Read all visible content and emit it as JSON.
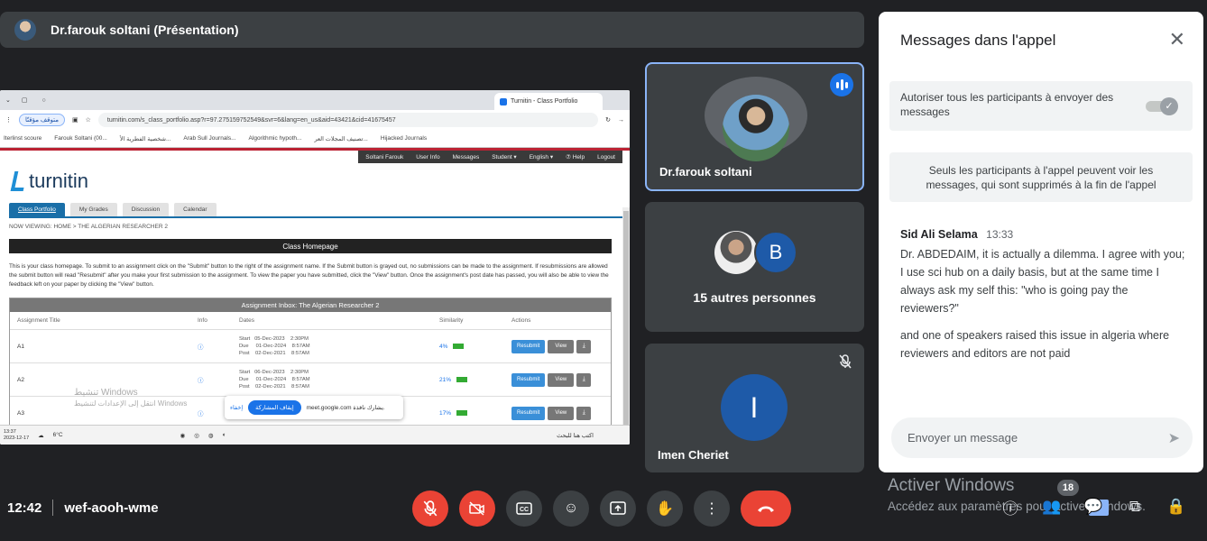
{
  "presenter": {
    "label": "Dr.farouk soltani (Présentation)"
  },
  "shared_screen": {
    "tab_title": "Turnitin - Class Portfolio",
    "pill_label": "متوقف مؤقتًا",
    "url": "turnitin.com/s_class_portfolio.asp?r=97.275159752549&svr=6&lang=en_us&aid=43421&cid=41675457",
    "bookmarks": [
      "Iterlinst scoure",
      "Farouk Soltani (00...",
      "شخصية الفطرية الأ...",
      "Arab Sull Journals...",
      "Algorithmic hypoth...",
      "تصنيف المجلات العر...",
      "Hijacked Journals"
    ],
    "topnav": [
      "Soltani Farouk",
      "User Info",
      "Messages",
      "Student ▾",
      "English ▾",
      "⑦ Help",
      "Logout"
    ],
    "logo": "turnitin",
    "tabs": [
      "Class Portfolio",
      "My Grades",
      "Discussion",
      "Calendar"
    ],
    "now_viewing": "NOW VIEWING: HOME > THE ALGERIAN RESEARCHER 2",
    "class_homepage": "Class Homepage",
    "intro": "This is your class homepage. To submit to an assignment click on the \"Submit\" button to the right of the assignment name. If the Submit button is grayed out, no submissions can be made to the assignment. If resubmissions are allowed the submit button will read \"Resubmit\" after you make your first submission to the assignment. To view the paper you have submitted, click the \"View\" button. Once the assignment's post date has passed, you will also be able to view the feedback left on your paper by clicking the \"View\" button.",
    "inbox_title": "Assignment Inbox: The Algerian Researcher 2",
    "columns": [
      "Assignment Title",
      "Info",
      "Dates",
      "Similarity",
      "Actions"
    ],
    "rows": [
      {
        "title": "A1",
        "dates": "Start   05-Dec-2023    2:30PM\nDue     01-Dec-2024    8:57AM\nPost    02-Dec-2021    8:57AM",
        "similarity": "4%"
      },
      {
        "title": "A2",
        "dates": "Start   06-Dec-2023    2:30PM\nDue     01-Dec-2024    8:57AM\nPost    02-Dec-2021    8:57AM",
        "similarity": "21%"
      },
      {
        "title": "A3",
        "dates": "",
        "similarity": "17%"
      }
    ],
    "resubmit_label": "Resubmit",
    "view_label": "View",
    "windows_watermark": "تنشيط Windows",
    "windows_watermark_sub": "انتقل إلى الإعدادات لتنشيط Windows",
    "share_banner": {
      "link": "إخفاء",
      "stop": "إيقاف المشاركة",
      "text": "meet.google.com يشارك نافذة."
    },
    "taskbar_time": "13:37\n2023-12-17",
    "taskbar_weather": "6°C",
    "taskbar_search": "اكتب هنا للبحث"
  },
  "tiles": [
    {
      "name": "Dr.farouk soltani",
      "speaking": true
    },
    {
      "label": "15 autres personnes",
      "initial": "B"
    },
    {
      "name": "Imen Cheriet",
      "initial": "I",
      "muted": true
    }
  ],
  "chat": {
    "title": "Messages dans l'appel",
    "allow_text": "Autoriser tous les participants à envoyer des messages",
    "allow_enabled": true,
    "info_text": "Seuls les participants à l'appel peuvent voir les messages, qui sont supprimés à la fin de l'appel",
    "messages": [
      {
        "sender": "Sid Ali Selama",
        "time": "13:33",
        "body": "Dr. ABDEDAIM, it is actually a dilemma. I agree with you; I use sci hub on a daily basis, but at the same time I always ask my self this: \"who is going pay the reviewers?\""
      },
      {
        "body": "and one of speakers raised this issue in algeria where reviewers and editors are not paid"
      }
    ],
    "input_placeholder": "Envoyer un message"
  },
  "windows_activation": {
    "title": "Activer Windows",
    "subtitle": "Accédez aux paramètres pour activer Windows."
  },
  "meeting": {
    "time": "12:42",
    "code": "wef-aooh-wme"
  },
  "participant_count": "18",
  "colors": {
    "accent": "#1a73e8",
    "danger": "#ea4335",
    "surface": "#3c4043",
    "background": "#202124"
  }
}
